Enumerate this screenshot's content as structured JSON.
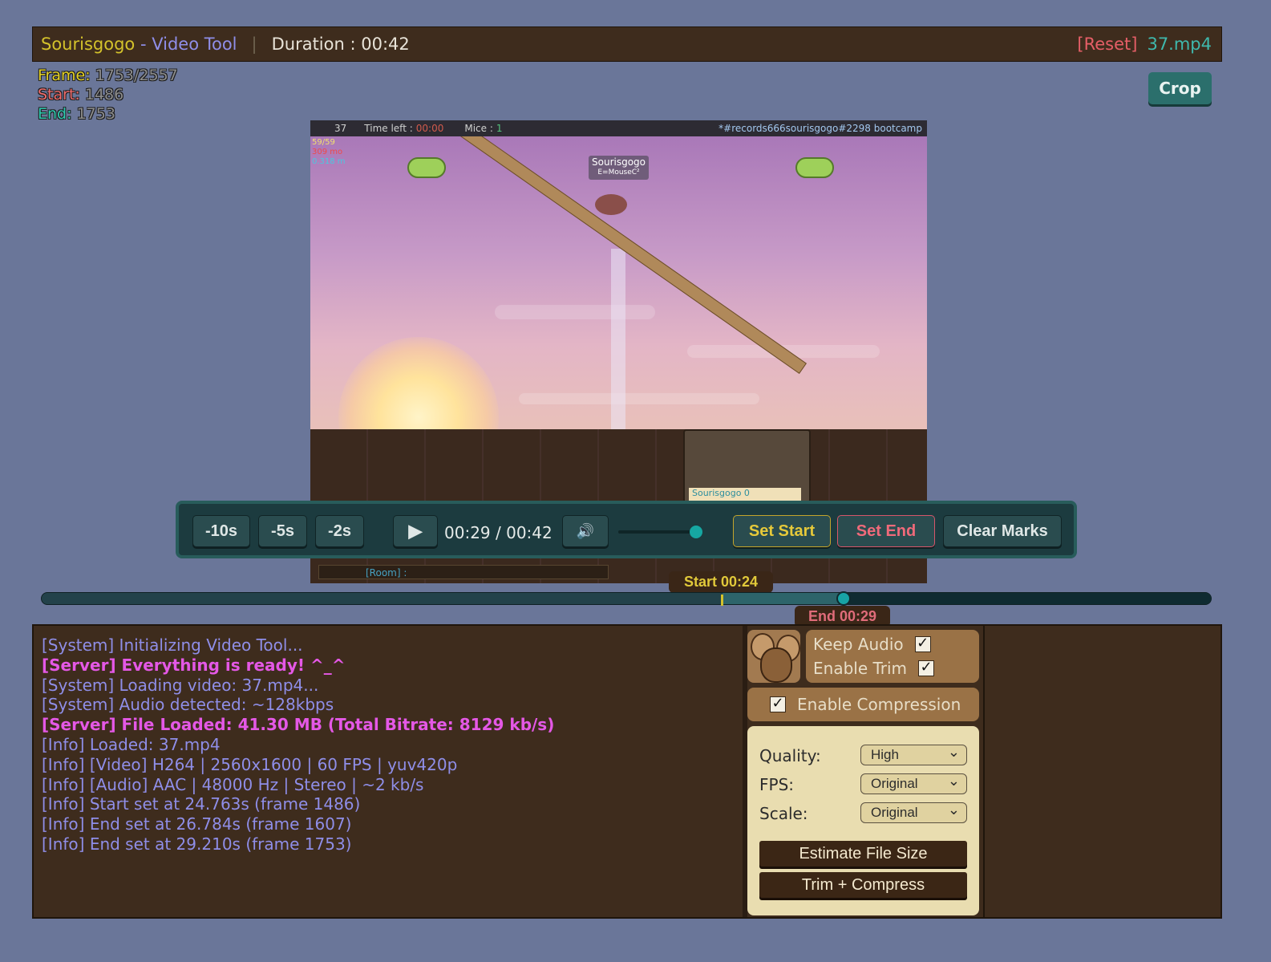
{
  "header": {
    "app_name": "Sourisgogo",
    "dash": " - ",
    "tool_name": "Video Tool",
    "separator": "|",
    "duration_label": "Duration : 00:42",
    "reset_label": "[Reset]",
    "file_name": "37.mp4"
  },
  "stats": {
    "frame_label": "Frame:",
    "frame_value": "1753/2557",
    "start_label": "Start:",
    "start_value": "1486",
    "end_label": "End:",
    "end_value": "1753"
  },
  "crop_label": "Crop",
  "video_overlay": {
    "level": "37",
    "time_left_label": "Time left :",
    "time_left_value": "00:00",
    "mice_label": "Mice :",
    "mice_value": "1",
    "room_title": "*#records666sourisgogo#2298 bootcamp",
    "mini_stat_1": "59/59",
    "mini_stat_2": "309 mo",
    "mini_stat_3": "0.318 m",
    "player_name": "Sourisgogo",
    "player_title": "E=MouseC²",
    "hud_name": "Sourisgogo 0",
    "chat_placeholder": "[Room] :"
  },
  "controls": {
    "back10": "-10s",
    "back5": "-5s",
    "back2": "-2s",
    "play_icon": "▶",
    "time_display": "00:29 / 00:42",
    "volume_icon": "🔊",
    "volume_level": 0.97,
    "set_start": "Set Start",
    "set_end": "Set End",
    "clear_marks": "Clear Marks"
  },
  "timeline": {
    "start_marker": "Start 00:24",
    "end_marker": "End 00:29",
    "start_fraction": 0.5814,
    "end_fraction": 0.6859
  },
  "log": [
    {
      "type": "sys",
      "text": "[System] Initializing Video Tool..."
    },
    {
      "type": "srv",
      "text": "[Server] Everything is ready! ^_^"
    },
    {
      "type": "sys",
      "text": "[System] Loading video: 37.mp4..."
    },
    {
      "type": "sys",
      "text": "[System] Audio detected: ~128kbps"
    },
    {
      "type": "srv",
      "text": "[Server] File Loaded: 41.30 MB (Total Bitrate: 8129 kb/s)"
    },
    {
      "type": "inf",
      "text": "[Info] Loaded: 37.mp4"
    },
    {
      "type": "inf",
      "text": "[Info] [Video] H264 | 2560x1600 | 60 FPS | yuv420p"
    },
    {
      "type": "inf",
      "text": "[Info] [Audio] AAC | 48000 Hz | Stereo | ~2 kb/s"
    },
    {
      "type": "inf",
      "text": "[Info] Start set at 24.763s (frame 1486)"
    },
    {
      "type": "inf",
      "text": "[Info] End set at 26.784s (frame 1607)"
    },
    {
      "type": "inf",
      "text": "[Info] End set at 29.210s (frame 1753)"
    }
  ],
  "options": {
    "keep_audio": "Keep Audio",
    "enable_trim": "Enable Trim",
    "enable_compression": "Enable Compression",
    "check_mark": "✓"
  },
  "settings": {
    "quality_label": "Quality:",
    "quality_value": "High",
    "fps_label": "FPS:",
    "fps_value": "Original",
    "scale_label": "Scale:",
    "scale_value": "Original",
    "estimate_button": "Estimate File Size",
    "trim_button": "Trim + Compress"
  },
  "colors": {
    "background": "#6a7699",
    "panel_brown": "#3e2c1d",
    "accent_teal": "#2b6f6c",
    "start_yellow": "#d4c22b",
    "end_red": "#e06c7a"
  }
}
